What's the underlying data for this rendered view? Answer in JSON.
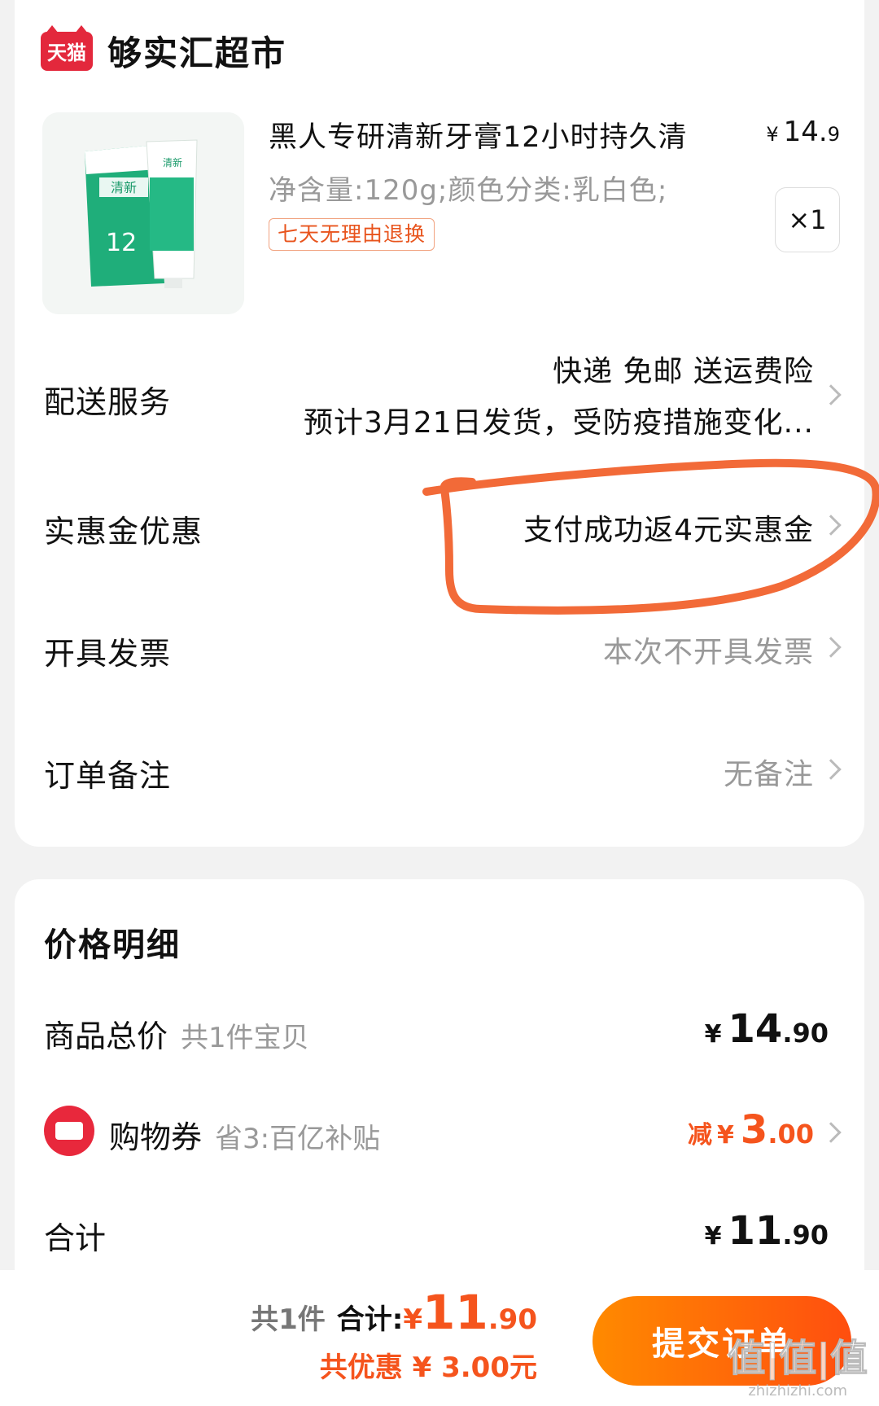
{
  "store": {
    "logo_text": "天猫",
    "name": "够实汇超市"
  },
  "product": {
    "title": "黑人专研清新牙膏12小时持久清",
    "price_yen": "¥",
    "price_int": "14.",
    "price_dec": "9",
    "spec": "净含量:120g;颜色分类:乳白色;",
    "tag": "七天无理由退换",
    "quantity": "×1",
    "image_icon": "toothpaste-product-image"
  },
  "rows": {
    "delivery": {
      "label": "配送服务",
      "value1": "快递 免邮 送运费险",
      "value2": "预计3月21日发货，受防疫措施变化..."
    },
    "discount": {
      "label": "实惠金优惠",
      "value": "支付成功返4元实惠金"
    },
    "invoice": {
      "label": "开具发票",
      "value": "本次不开具发票"
    },
    "remark": {
      "label": "订单备注",
      "value": "无备注"
    }
  },
  "price_detail": {
    "title": "价格明细",
    "goods_total": {
      "label": "商品总价",
      "sub": "共1件宝贝",
      "yen": "¥",
      "int": "14",
      "dec": ".90"
    },
    "coupon": {
      "label": "购物券",
      "sub": "省3:百亿补贴",
      "prefix": "减",
      "yen": "¥",
      "int": "3",
      "dec": ".00"
    },
    "sum": {
      "label": "合计",
      "yen": "¥",
      "int": "11",
      "dec": ".90"
    }
  },
  "bottom": {
    "count": "共1件",
    "total_label": "合计:",
    "yen": "¥",
    "int": "11",
    "dec": ".90",
    "saved": "共优惠 ¥ 3.00元",
    "submit_label": "提交订单"
  },
  "watermark": {
    "big": "值|值|值",
    "small": "zhizhizhi.com"
  },
  "colors": {
    "accent": "#f5541d",
    "tmall_red": "#e3283c",
    "annotation": "#f26a38"
  }
}
